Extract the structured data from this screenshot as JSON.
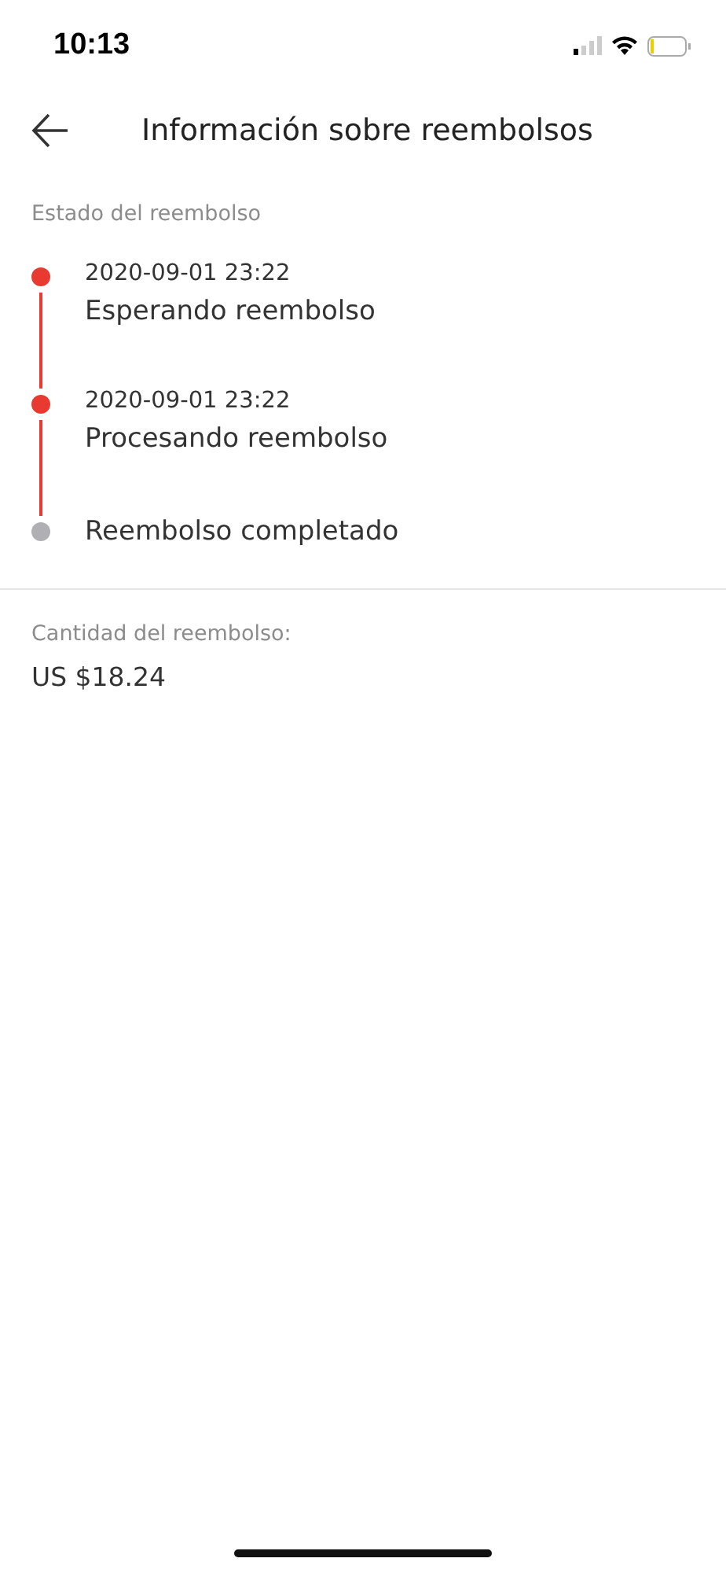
{
  "status_bar": {
    "time": "10:13"
  },
  "header": {
    "title": "Información sobre reembolsos"
  },
  "refund_status": {
    "label": "Estado del reembolso",
    "steps": [
      {
        "date": "2020-09-01 23:22",
        "label": "Esperando reembolso",
        "done": true
      },
      {
        "date": "2020-09-01 23:22",
        "label": "Procesando reembolso",
        "done": true
      },
      {
        "label": "Reembolso completado",
        "done": false
      }
    ]
  },
  "refund_amount": {
    "label": "Cantidad del reembolso:",
    "value": "US $18.24"
  }
}
